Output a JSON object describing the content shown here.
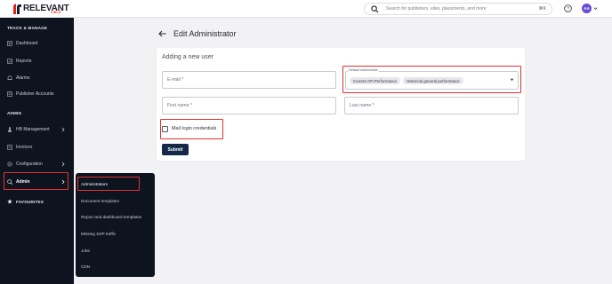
{
  "brand": {
    "name": "RELEVANT",
    "tagline": "YIELD",
    "accent": "#e2231a"
  },
  "topbar": {
    "search_placeholder": "Search for publishers, sites, placements, and more",
    "search_shortcut": "⌘K",
    "avatar_initials": "AA",
    "icons": [
      "search-icon",
      "help-icon",
      "chevron-down-icon"
    ]
  },
  "sidebar": {
    "sections": [
      {
        "label": "TRACK & MANAGE"
      },
      {
        "label": "ADMIN"
      }
    ],
    "items": [
      {
        "label": "Dashboard",
        "icon": "dashboard-icon"
      },
      {
        "label": "Reports",
        "icon": "reports-icon"
      },
      {
        "label": "Alarms",
        "icon": "alarm-icon"
      },
      {
        "label": "Publisher Accounts",
        "icon": "publisher-icon"
      },
      {
        "label": "HB Management",
        "icon": "hb-icon",
        "has_submenu": true
      },
      {
        "label": "Invoices",
        "icon": "invoice-icon"
      },
      {
        "label": "Configuration",
        "icon": "gear-icon",
        "has_submenu": true
      },
      {
        "label": "Admin",
        "icon": "admin-icon",
        "has_submenu": true,
        "active": true
      }
    ],
    "favourites_label": "FAVOURITES"
  },
  "flyout": {
    "items": [
      {
        "label": "Administrators",
        "selected": true
      },
      {
        "label": "Document templates"
      },
      {
        "label": "Report and dashboard templates"
      },
      {
        "label": "Missing SSP traffic"
      },
      {
        "label": "Jobs"
      },
      {
        "label": "CDN"
      }
    ]
  },
  "page": {
    "title": "Edit Administrator",
    "card_title": "Adding a new user",
    "form": {
      "email_placeholder": "E-mail *",
      "first_name_placeholder": "First name *",
      "last_name_placeholder": "Last name *",
      "dashboards_label": "Default dashboards",
      "dashboards_selected": [
        "Current API Performance",
        "Historical general performance"
      ],
      "mail_credentials_label": "Mail login credentials",
      "mail_credentials_checked": false,
      "submit_label": "Submit"
    }
  },
  "colors": {
    "sidebar_bg": "#0d1420",
    "highlight_red": "#e0322e",
    "submit_bg": "#14294a",
    "avatar_bg": "#6a4bd6"
  }
}
